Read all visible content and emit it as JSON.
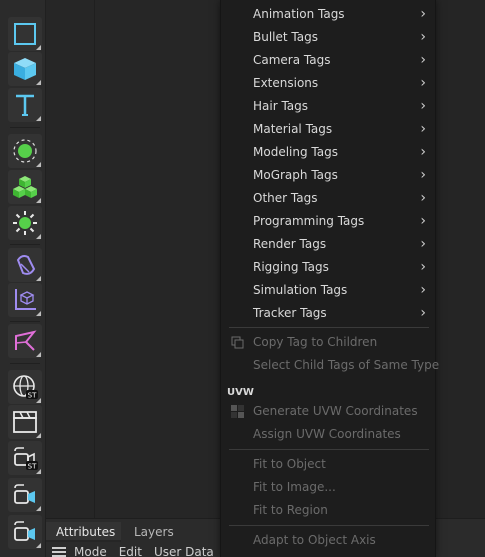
{
  "toolbar": {
    "buttons": [
      {
        "name": "cube-outline-icon"
      },
      {
        "name": "cube-primitive-icon"
      },
      {
        "name": "text-spline-icon"
      },
      {
        "name": "null-object-icon"
      },
      {
        "name": "cloner-icon"
      },
      {
        "name": "generator-icon"
      },
      {
        "name": "deformer-icon"
      },
      {
        "name": "field-icon"
      },
      {
        "name": "spline-pen-icon"
      },
      {
        "name": "environment-sky-icon"
      },
      {
        "name": "scene-clapper-icon"
      },
      {
        "name": "camera-st-icon"
      },
      {
        "name": "camera-icon"
      },
      {
        "name": "camera-2-icon"
      }
    ],
    "badge_st": "ST"
  },
  "context_menu": {
    "items": [
      {
        "label": "Animation Tags",
        "submenu": true
      },
      {
        "label": "Bullet Tags",
        "submenu": true
      },
      {
        "label": "Camera Tags",
        "submenu": true
      },
      {
        "label": "Extensions",
        "submenu": true
      },
      {
        "label": "Hair Tags",
        "submenu": true
      },
      {
        "label": "Material Tags",
        "submenu": true
      },
      {
        "label": "Modeling Tags",
        "submenu": true
      },
      {
        "label": "MoGraph Tags",
        "submenu": true
      },
      {
        "label": "Other Tags",
        "submenu": true
      },
      {
        "label": "Programming Tags",
        "submenu": true
      },
      {
        "label": "Render Tags",
        "submenu": true
      },
      {
        "label": "Rigging Tags",
        "submenu": true
      },
      {
        "label": "Simulation Tags",
        "submenu": true
      },
      {
        "label": "Tracker Tags",
        "submenu": true
      }
    ],
    "copy_tag": "Copy Tag to Children",
    "select_child": "Select Child Tags of Same Type",
    "uvw_header": "UVW",
    "generate_uvw": "Generate UVW Coordinates",
    "assign_uvw": "Assign UVW Coordinates",
    "fit_object": "Fit to Object",
    "fit_image": "Fit to Image...",
    "fit_region": "Fit to Region",
    "adapt_axis": "Adapt to Object Axis",
    "chevron": "›"
  },
  "bottom_panel": {
    "tabs": [
      "Attributes",
      "Layers"
    ],
    "menu": [
      "Mode",
      "Edit",
      "User Data"
    ]
  },
  "colors": {
    "menu_bg": "#1d1d1d",
    "disabled_text": "#6b6b6b",
    "icon_cyan": "#5cc8f0",
    "icon_green": "#56d04a",
    "icon_purple": "#9f8cf0",
    "icon_pink": "#e06fd8"
  }
}
